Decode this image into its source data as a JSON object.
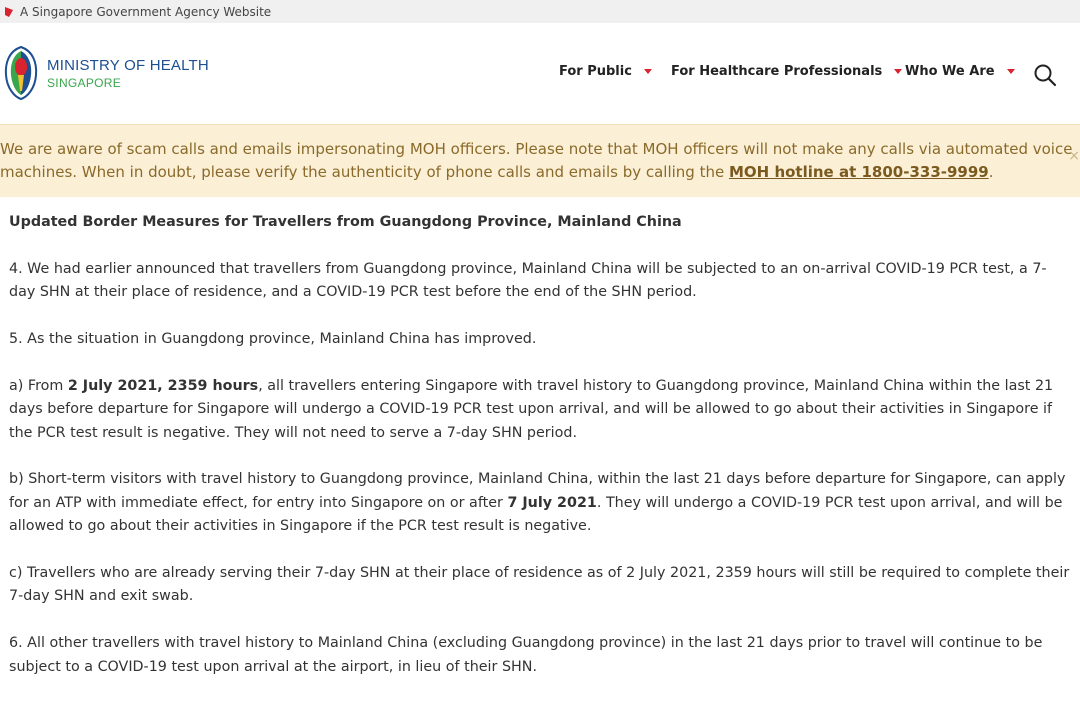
{
  "masthead": {
    "text": "A Singapore Government Agency Website"
  },
  "brand": {
    "title": "MINISTRY OF HEALTH",
    "subtitle": "SINGAPORE"
  },
  "nav": {
    "items": [
      {
        "label": "For Public"
      },
      {
        "label": "For Healthcare Professionals"
      },
      {
        "label": "Who We Are"
      }
    ]
  },
  "alert": {
    "line1": "We are aware of scam calls and emails impersonating MOH officers. Please note that MOH officers will not make any calls via automated voice",
    "line2_prefix": "machines. When in doubt, please verify the authenticity of phone calls and emails by calling the ",
    "hotline_link": "MOH hotline at 1800-333-9999",
    "line2_suffix": ".",
    "close_symbol": "×"
  },
  "article": {
    "heading": "Updated Border Measures for Travellers from Guangdong Province, Mainland China",
    "para4": "4.   We had earlier announced that travellers from Guangdong province, Mainland China will be subjected to an on-arrival COVID-19 PCR test, a 7-day SHN at their place of residence, and a COVID-19 PCR test before the end of the SHN period.",
    "para5": "5.   As the situation in Guangdong province, Mainland China has improved.",
    "para_a_prefix": "a) From ",
    "para_a_bold": "2 July 2021, 2359 hours",
    "para_a_suffix": ", all travellers entering Singapore with travel history to Guangdong province, Mainland China within the last 21 days before departure for Singapore will undergo a COVID-19 PCR test upon arrival, and will be allowed to go about their activities in Singapore if the PCR test result is negative. They will not need to serve a 7-day SHN period.",
    "para_b_prefix": "b) Short-term visitors with travel history to Guangdong province, Mainland China, within the last 21 days before departure for Singapore, can apply for an ATP with immediate effect, for entry into Singapore on or after ",
    "para_b_bold": "7 July 2021",
    "para_b_suffix": ". They will undergo a COVID-19 PCR test upon arrival, and will be allowed to go about their activities in Singapore if the PCR test result is negative.",
    "para_c": "c)  Travellers who are already serving their 7-day SHN at their place of residence as of 2 July 2021, 2359 hours will still be required to complete their 7-day SHN and exit swab.",
    "para6": "6.   All other travellers with travel history to Mainland China (excluding Guangdong province) in the last 21 days prior to travel will continue to be subject to a COVID-19 test upon arrival at the airport, in lieu of their SHN."
  },
  "colors": {
    "brand_blue": "#1d4f91",
    "brand_green": "#3aa64c",
    "caret_red": "#d9232e",
    "alert_bg": "#fbf0d6",
    "alert_text": "#8a6a2a"
  },
  "icons": {
    "masthead": "lion-head-icon",
    "search": "search-icon",
    "dropdown": "chevron-down-icon"
  }
}
